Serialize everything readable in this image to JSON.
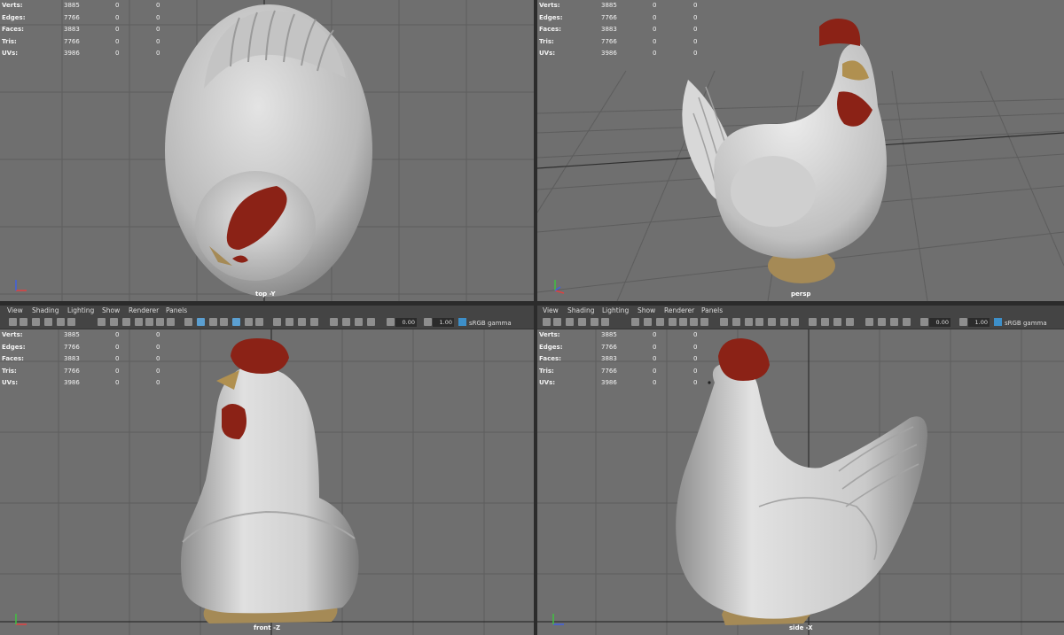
{
  "stats": {
    "rows": [
      {
        "label": "Verts:",
        "v1": "3885",
        "v2": "0",
        "v3": "0"
      },
      {
        "label": "Edges:",
        "v1": "7766",
        "v2": "0",
        "v3": "0"
      },
      {
        "label": "Faces:",
        "v1": "3883",
        "v2": "0",
        "v3": "0"
      },
      {
        "label": "Tris:",
        "v1": "7766",
        "v2": "0",
        "v3": "0"
      },
      {
        "label": "UVs:",
        "v1": "3986",
        "v2": "0",
        "v3": "0"
      }
    ]
  },
  "panels": {
    "top": {
      "camera": "top -Y"
    },
    "persp": {
      "camera": "persp"
    },
    "front": {
      "camera": "front -Z"
    },
    "side": {
      "camera": "side -X"
    }
  },
  "panel_menu": {
    "view": "View",
    "shading": "Shading",
    "lighting": "Lighting",
    "show": "Show",
    "renderer": "Renderer",
    "panels": "Panels"
  },
  "panel_toolbar": {
    "exposure": "0.00",
    "gamma": "1.00",
    "color_space": "sRGB gamma"
  },
  "colors": {
    "viewport_bg": "#6f6f6f",
    "panel_ui": "#444444",
    "highlight": "#5b9fd1",
    "comb": "#8b2216",
    "body": "#d2d2d2",
    "feet": "#a58a56"
  }
}
